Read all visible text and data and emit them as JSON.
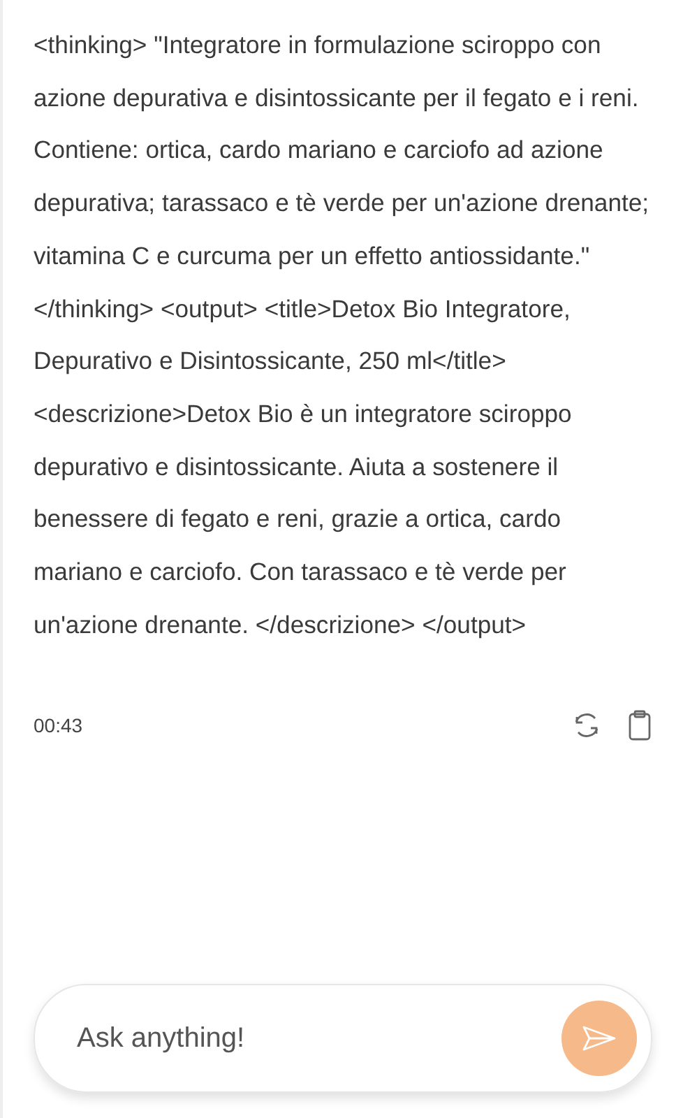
{
  "message": {
    "text": "<thinking> \"Integratore in formulazione sciroppo con azione depurativa e disintossicante per il fegato e i reni. Contiene: ortica, cardo mariano e carciofo ad azione depurativa; tarassaco e tè verde per un'azione drenante; vitamina C e curcuma per un effetto antiossidante.\" </thinking> <output> <title>Detox Bio Integratore, Depurativo e Disintossicante, 250 ml</title> <descrizione>Detox Bio è un integratore sciroppo depurativo e disintossicante. Aiuta a sostenere il benessere di fegato e reni, grazie a ortica, cardo mariano e carciofo. Con tarassaco e tè verde per un'azione drenante. </descrizione> </output>",
    "time": "00:43"
  },
  "composer": {
    "placeholder": "Ask anything!"
  }
}
